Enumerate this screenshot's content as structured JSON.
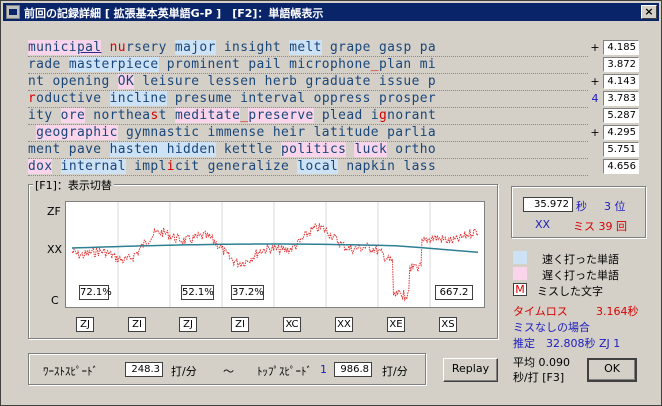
{
  "window": {
    "title": "前回の記録詳細 [ 拡張基本英単語G-P ]　[F2]：単語帳表示",
    "close_label": "×"
  },
  "lines": [
    {
      "mark": "+",
      "value": "4.185",
      "segs": [
        [
          "munici",
          "p"
        ],
        [
          "pal",
          "kp"
        ],
        [
          " n",
          "r"
        ],
        [
          "u",
          "r"
        ],
        [
          "rsery ",
          "n"
        ],
        [
          "major",
          " b"
        ],
        [
          " insight ",
          "n"
        ],
        [
          "melt",
          "b"
        ],
        [
          " grape gasp pa",
          "n"
        ]
      ]
    },
    {
      "mark": "",
      "value": "3.872",
      "segs": [
        [
          "rade ",
          "n"
        ],
        [
          "masterpiece",
          "b"
        ],
        [
          " prominent pail microphone",
          ""
        ],
        [
          "_",
          "r"
        ],
        [
          "plan mi",
          ""
        ]
      ]
    },
    {
      "mark": "+",
      "value": "4.143",
      "segs": [
        [
          "nt opening ",
          ""
        ],
        [
          "OK",
          "p"
        ],
        [
          " leisure lessen herb graduate issue p",
          ""
        ]
      ]
    },
    {
      "mark": "4",
      "value": "3.783",
      "segs": [
        [
          "r",
          "r"
        ],
        [
          "oductive ",
          ""
        ],
        [
          "incline",
          "b"
        ],
        [
          " presume interval oppress prosper",
          ""
        ]
      ]
    },
    {
      "mark": "",
      "value": "5.287",
      "segs": [
        [
          "ity ",
          ""
        ],
        [
          "ore",
          "p"
        ],
        [
          " northea",
          ""
        ],
        [
          "s",
          "r"
        ],
        [
          "t ",
          ""
        ],
        [
          "meditate",
          "p"
        ],
        [
          "_",
          "r"
        ],
        [
          "preserve",
          "p"
        ],
        [
          " plead i",
          ""
        ],
        [
          "g",
          "r"
        ],
        [
          "norant",
          ""
        ]
      ]
    },
    {
      "mark": "+",
      "value": "4.295",
      "segs": [
        [
          " ",
          ""
        ],
        [
          "geographic",
          "p"
        ],
        [
          " gymnastic immense heir latitude parlia",
          ""
        ]
      ]
    },
    {
      "mark": "",
      "value": "5.751",
      "segs": [
        [
          "ment pave ",
          ""
        ],
        [
          "hasten hidden",
          "b"
        ],
        [
          " kettle ",
          ""
        ],
        [
          "politics",
          "p"
        ],
        [
          " ",
          ""
        ],
        [
          "luck",
          "p"
        ],
        [
          " ortho",
          ""
        ]
      ]
    },
    {
      "mark": "",
      "value": "4.656",
      "segs": [
        [
          "dox",
          "p"
        ],
        [
          " ",
          ""
        ],
        [
          "internal",
          "b"
        ],
        [
          " impl",
          ""
        ],
        [
          "i",
          "r"
        ],
        [
          "cit generalize ",
          ""
        ],
        [
          "local",
          "b"
        ],
        [
          " napkin lass",
          ""
        ]
      ]
    }
  ],
  "group": {
    "label": "[F1]：表示切替"
  },
  "chart_data": {
    "type": "line",
    "y_labels": [
      "ZF",
      "XX",
      "C"
    ],
    "boxes": [
      "72.1%",
      "52.1%",
      "37.2%",
      "667.2"
    ],
    "x_buttons": [
      "ZJ",
      "ZI",
      "ZJ",
      "ZI",
      "XC",
      "XX",
      "XE",
      "XS"
    ],
    "colors": {
      "actual": "#e03030",
      "average": "#2f7f92"
    }
  },
  "stats": {
    "time": "35.972",
    "sec_label": "秒",
    "rank": "3 位",
    "grade": "XX",
    "miss_label": "ミス 39 回"
  },
  "legend": {
    "fast": "速く打った単語",
    "slow": "遅く打った単語",
    "miss_mark": "M",
    "miss_text": "ミスした文字",
    "colors": {
      "fast": "#cde2f5",
      "slow": "#fad4ea",
      "miss": "#d80000"
    }
  },
  "loss": {
    "label": "タイムロス",
    "value": "3.164秒",
    "nomiss_label": "ミスなしの場合",
    "estimate": "推定　32.808秒 ZJ 1"
  },
  "speed": {
    "worst_label": "ﾜｰｽﾄｽﾋﾟｰﾄﾞ",
    "worst_value": "248.3",
    "unit": "打/分",
    "tilde": "～",
    "top_label": "ﾄｯﾌﾟｽﾋﾟｰﾄﾞ",
    "top_rank": "1",
    "top_value": "986.8"
  },
  "buttons": {
    "replay": "Replay",
    "ok": "OK"
  },
  "avg": {
    "line1": "平均 0.090",
    "line2": "秒/打 [F3]"
  }
}
